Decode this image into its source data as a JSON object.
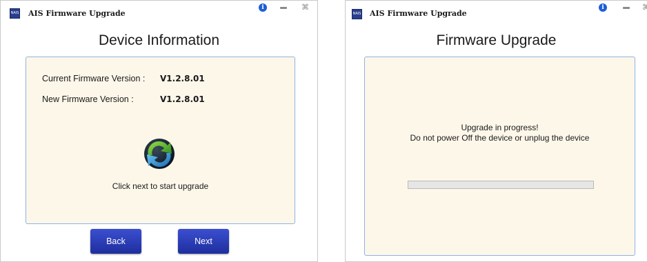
{
  "device_window": {
    "app_title": "AIS Firmware Upgrade",
    "app_icon_text": "NAIS",
    "heading": "Device Information",
    "current_fw_label": "Current Firmware Version :",
    "current_fw_value": "V1.2.8.01",
    "new_fw_label": "New Firmware Version :",
    "new_fw_value": "V1.2.8.01",
    "instruction": "Click next to start upgrade",
    "back_label": "Back",
    "next_label": "Next",
    "icons": [
      "info-icon",
      "minimize-icon",
      "close-icon",
      "upgrade-icon"
    ]
  },
  "upgrade_window": {
    "app_title": "AIS Firmware Upgrade",
    "app_icon_text": "NAIS",
    "heading": "Firmware Upgrade",
    "status_line1": "Upgrade in progress!",
    "status_line2": "Do not power Off the device or unplug the device",
    "progress_percent": 0,
    "icons": [
      "info-icon",
      "minimize-icon",
      "close-icon"
    ]
  },
  "colors": {
    "panel_background": "#fdf7ea",
    "panel_border": "#8fb3e0",
    "button": "#2a3cc0",
    "info_icon": "#1e5fd6",
    "upgrade_icon_green": "#3aa12c",
    "upgrade_icon_blue": "#1f8fd0"
  }
}
